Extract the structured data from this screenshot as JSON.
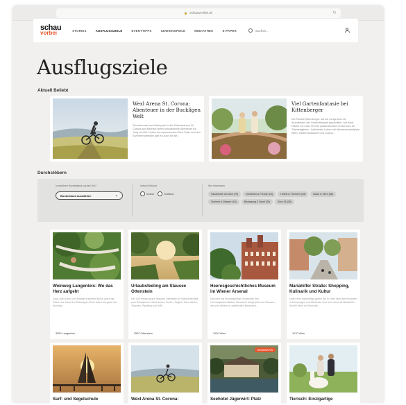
{
  "browser": {
    "url": "schauvorbei.at"
  },
  "header": {
    "logo_top": "schau",
    "logo_bottom": "vorbei",
    "nav": [
      "STORIES",
      "AUSFLUGSZIELE",
      "EVENTTIPPS",
      "GEWINNSPIELE",
      "MEDIATHEK",
      "E-PAPER"
    ],
    "active_nav": "AUSFLUGSZIELE",
    "search_placeholder": "Suchen..."
  },
  "page": {
    "title": "Ausflugsziele",
    "popular_heading": "Aktuell Beliebt",
    "browse_heading": "Durchstöbern"
  },
  "featured": [
    {
      "title": "Wexl Arena St. Corona: Abenteuer in der Buckligen Welt",
      "desc": "Sommerrodel und Naturpark in der Erlebnisarena St. Corona am Wechsel bietet sensationelle Abenteuer für Jung und Alt. Neben den spannenden Wexl Trails und den Sommerrodelbahn gibt es auch für die..."
    },
    {
      "title": "Viel Gartenfantasie bei Kittenberger",
      "desc": "Die Familie Kittenberger hat bei Langenlois ein Wunderland der Gartenfantasie geschaffen. Auf einer Fläche von über 50.000 Quadratmetern finden sich 30 Themengärten - kultiviertes Leben mit Abenteuerspielplatz, Wein, Gartenrestaurant und Cucina..."
    }
  ],
  "filter": {
    "state_label": "In welchem Bundesland suchen Sie?",
    "state_select": "Bundesland auswählen",
    "io_label": "Indoor/Outdoor",
    "indoor": "Indoor",
    "outdoor": "Outdoor",
    "interests_label": "Ihre Interessen",
    "chips": [
      "Geschichte & Kultur (79)",
      "Genießen & Freude (24)",
      "Hotels & Thermen (35)",
      "Natur & Tiere (56)",
      "Schiene & Wasser (16)",
      "Bewegung & Sport (33)",
      "Bum 36 (28)"
    ]
  },
  "cards": [
    {
      "title": "Weinweg Langenlois: Wo das Herz aufgeht",
      "desc": "Jung, Alter Ulrich von Bilstein erscheint Blicke durch die Reben zur Kunst im Weinwegort Dorm fallen auf ganz den Kirchlspi...",
      "loc": "3550 Langenlois"
    },
    {
      "title": "Urlaubsfeeling am Stausee Ottenstein",
      "desc": "Der 430 Hektar große Stausee Ottenstein im Waldviertel lädt zum Schwimmen, Boot fahren, Surfen, Segeln, Kanu fahren, Tauchen, Paddling und SUP...",
      "loc": "3532 Ottenstein"
    },
    {
      "title": "Heeresgeschichtliches Museum im Wiener Arsenal",
      "desc": "Die mehr als hundertjährige Geschichte des Heeresgeschichtlichen Museums bringt jeden ins Staunen, der sein Wissen in zahlreichen Bereichen...",
      "loc": "1030 Wien"
    },
    {
      "title": "Mariahilfer Straße: Shopping, Kulinarik und Kultur",
      "desc": "Unter dem Nachmittag gehen Sie in einer über drei Kilometer in Kreuzzügen und Muscheln zum hier schon ist Mariahilfer Straße Wien im Sinne die...",
      "loc": "1070 Wien"
    },
    {
      "title": "Surf- und Segelschule",
      "desc": "",
      "loc": ""
    },
    {
      "title": "Wexl Arena St. Corona:",
      "desc": "",
      "loc": ""
    },
    {
      "title": "Seehotel Jägerwirt: Platz",
      "desc": "",
      "loc": "",
      "badge": "GEWINNSPIEL"
    },
    {
      "title": "Tierisch: Einzigartige",
      "desc": "",
      "loc": ""
    }
  ],
  "colors": {
    "accent": "#e8552d",
    "page_bg": "#f1f0ee"
  }
}
